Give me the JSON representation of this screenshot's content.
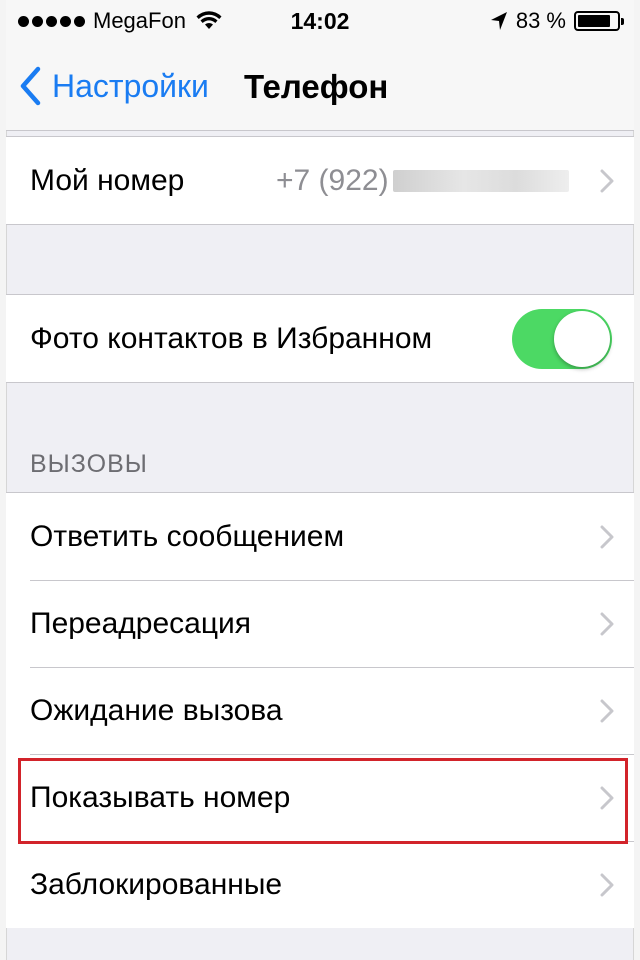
{
  "status_bar": {
    "carrier": "MegaFon",
    "time": "14:02",
    "battery_text": "83 %",
    "battery_level": 0.83,
    "icons": [
      "signal-dots-icon",
      "wifi-icon",
      "location-arrow-icon",
      "battery-icon"
    ]
  },
  "nav": {
    "back_label": "Настройки",
    "title": "Телефон"
  },
  "my_number": {
    "label": "Мой номер",
    "value": "+7 (922)"
  },
  "favorites_photo": {
    "label": "Фото контактов в Избранном",
    "toggle_on": true
  },
  "calls_section": {
    "header": "ВЫЗОВЫ",
    "items": [
      {
        "label": "Ответить сообщением"
      },
      {
        "label": "Переадресация"
      },
      {
        "label": "Ожидание вызова"
      },
      {
        "label": "Показывать номер"
      },
      {
        "label": "Заблокированные"
      }
    ]
  },
  "colors": {
    "accent": "#1a7cf2",
    "toggle_on": "#4cd964",
    "highlight": "#d2232a",
    "background": "#efeff4"
  }
}
